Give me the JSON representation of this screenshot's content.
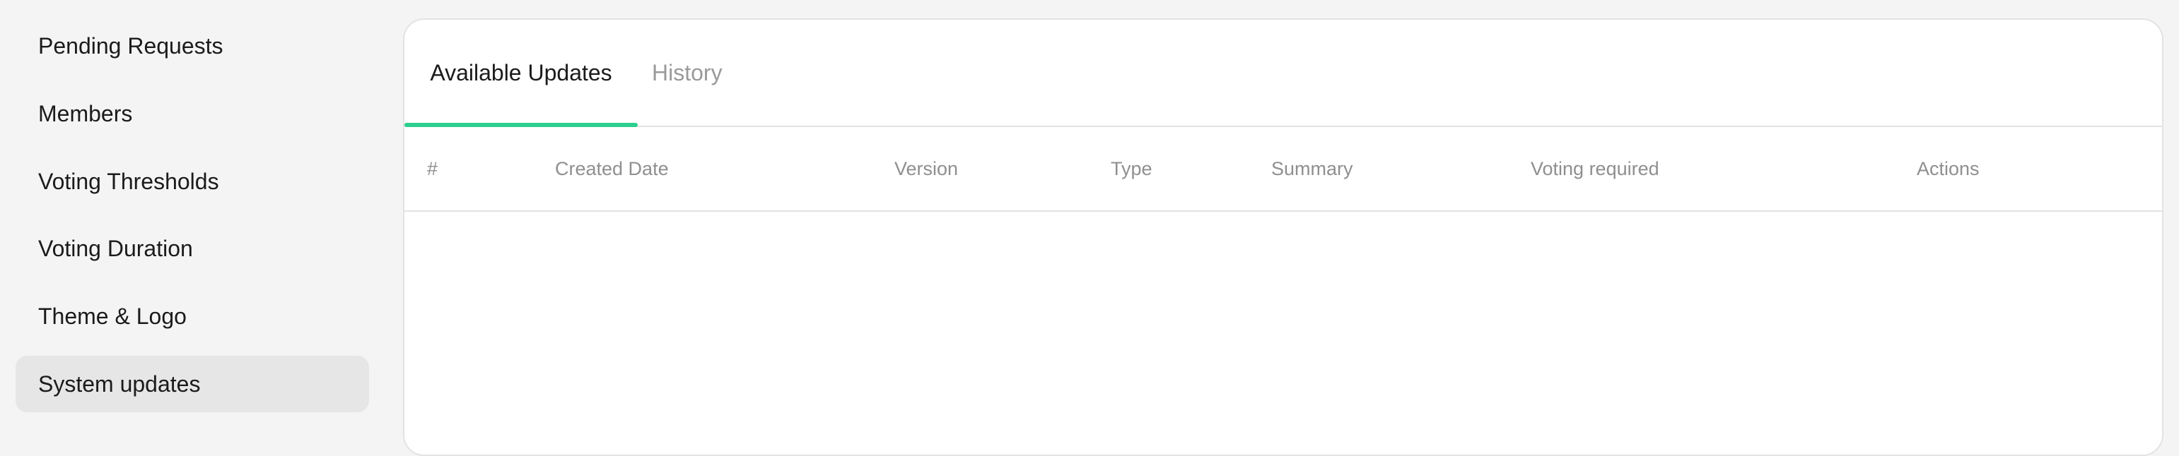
{
  "sidebar": {
    "items": [
      {
        "label": "Pending Requests"
      },
      {
        "label": "Members"
      },
      {
        "label": "Voting Thresholds"
      },
      {
        "label": "Voting Duration"
      },
      {
        "label": "Theme & Logo"
      },
      {
        "label": "System updates",
        "active": true
      }
    ]
  },
  "tabs": [
    {
      "label": "Available Updates",
      "active": true
    },
    {
      "label": "History",
      "active": false
    }
  ],
  "table": {
    "columns": [
      "#",
      "Created Date",
      "Version",
      "Type",
      "Summary",
      "Voting required",
      "Actions"
    ],
    "rows": []
  },
  "colors": {
    "accent": "#2ccf8e",
    "background": "#f4f4f4",
    "panel": "#ffffff",
    "muted_text": "#8f8f8f"
  }
}
